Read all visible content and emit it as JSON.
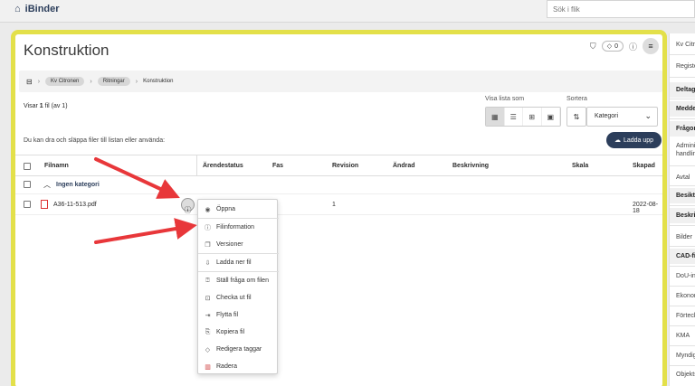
{
  "app": {
    "name": "iBinder",
    "home_icon": "home-icon"
  },
  "search": {
    "placeholder": "Sök i flik"
  },
  "page": {
    "title": "Konstruktion",
    "badge_count": "0"
  },
  "breadcrumb": {
    "items": [
      "Kv Citronen",
      "Ritningar"
    ],
    "current": "Konstruktion"
  },
  "listing": {
    "prefix": "Visar ",
    "count": "1",
    "suffix": " fil (av 1)"
  },
  "view": {
    "label": "Visa lista som"
  },
  "sort": {
    "label": "Sortera",
    "value": "Kategori"
  },
  "drop_hint": "Du kan dra och släppa filer till listan eller använda:",
  "upload_label": "Ladda upp",
  "table": {
    "columns": [
      "Filnamn",
      "Ärendestatus",
      "Fas",
      "Revision",
      "Ändrad",
      "Beskrivning",
      "Skala",
      "Skapad"
    ],
    "group": "Ingen kategori",
    "rows": [
      {
        "filename": "A36-11-513.pdf",
        "revision": "1",
        "created": "2022-08-18"
      }
    ]
  },
  "context_menu": [
    {
      "label": "Öppna",
      "icon": "eye-icon"
    },
    {
      "label": "Filinformation",
      "icon": "info-icon"
    },
    {
      "label": "Versioner",
      "icon": "versions-icon"
    },
    {
      "label": "Ladda ner fil",
      "icon": "download-icon"
    },
    {
      "label": "Ställ fråga om filen",
      "icon": "question-icon"
    },
    {
      "label": "Checka ut fil",
      "icon": "lock-icon"
    },
    {
      "label": "Flytta fil",
      "icon": "move-icon"
    },
    {
      "label": "Kopiera fil",
      "icon": "copy-icon"
    },
    {
      "label": "Redigera taggar",
      "icon": "tag-icon"
    },
    {
      "label": "Radera",
      "icon": "trash-icon"
    }
  ],
  "right_panel": [
    {
      "label": "Kv Citronen",
      "bold": false
    },
    {
      "label": "Register",
      "bold": false
    },
    {
      "label": "Deltagare",
      "bold": true
    },
    {
      "label": "Meddelanden",
      "bold": true
    },
    {
      "label": "Frågor",
      "bold": true
    },
    {
      "label": "Administrativa handlingar",
      "bold": false
    },
    {
      "label": "Avtal",
      "bold": false
    },
    {
      "label": "Besiktning",
      "bold": true
    },
    {
      "label": "Beskrivningar",
      "bold": true
    },
    {
      "label": "Bilder",
      "bold": false
    },
    {
      "label": "CAD-filer",
      "bold": true
    },
    {
      "label": "DoU-instruktioner",
      "bold": false
    },
    {
      "label": "Ekonomi",
      "bold": false
    },
    {
      "label": "Förteckningar",
      "bold": false
    },
    {
      "label": "KMA",
      "bold": false
    },
    {
      "label": "Myndigheter",
      "bold": false
    },
    {
      "label": "Objektsbeskrivningar",
      "bold": false
    }
  ],
  "colors": {
    "highlight": "#e3e04a",
    "primary": "#2c3e5b",
    "arrow": "#e8373a"
  }
}
